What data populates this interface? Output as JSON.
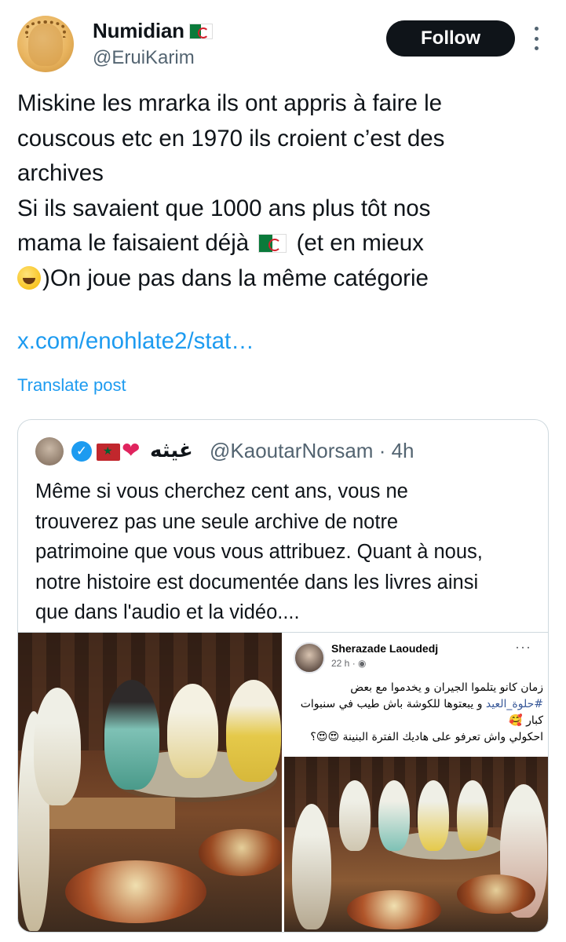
{
  "author": {
    "name": "Numidian",
    "handle": "@EruiKarim",
    "flag_icon": "algeria-flag-icon"
  },
  "actions": {
    "follow_label": "Follow",
    "more_icon": "more-vertical-icon"
  },
  "post": {
    "lines": [
      "Miskine les mrarka ils ont appris à faire le",
      "couscous etc en 1970 ils croient c’est des",
      "archives",
      "Si ils savaient que 1000 ans plus tôt nos",
      "mama le faisaient déjà",
      "(et en mieux",
      ")On joue pas dans la même catégorie"
    ],
    "link": "x.com/enohlate2/stat…",
    "translate_label": "Translate post"
  },
  "quote": {
    "name": "غيثه",
    "handle_time": "@KaoutarNorsam · 4h",
    "lines": [
      "Même si vous cherchez cent ans, vous ne",
      "trouverez pas une seule archive de notre",
      "patrimoine que vous vous attribuez. Quant à nous,",
      "notre histoire est documentée dans les livres ainsi",
      "que dans l'audio et la vidéo...."
    ],
    "fb": {
      "name": "Sherazade Laoudedj",
      "time": "22 h · ",
      "more": "···",
      "lines": [
        "زمان كانو يتلموا الجيران و يخدموا مع بعض",
        "و يبعتوها للكوشة باش طيب في سنبوات",
        "#حلوة_العيد",
        "كبار 🥰",
        "احكولي واش تعرفو على هاديك الفترة البنينة 😍😍؟"
      ]
    }
  },
  "colors": {
    "link_blue": "#1d9bf0",
    "text": "#0f1419",
    "muted": "#536471",
    "border": "#cfd9de"
  }
}
